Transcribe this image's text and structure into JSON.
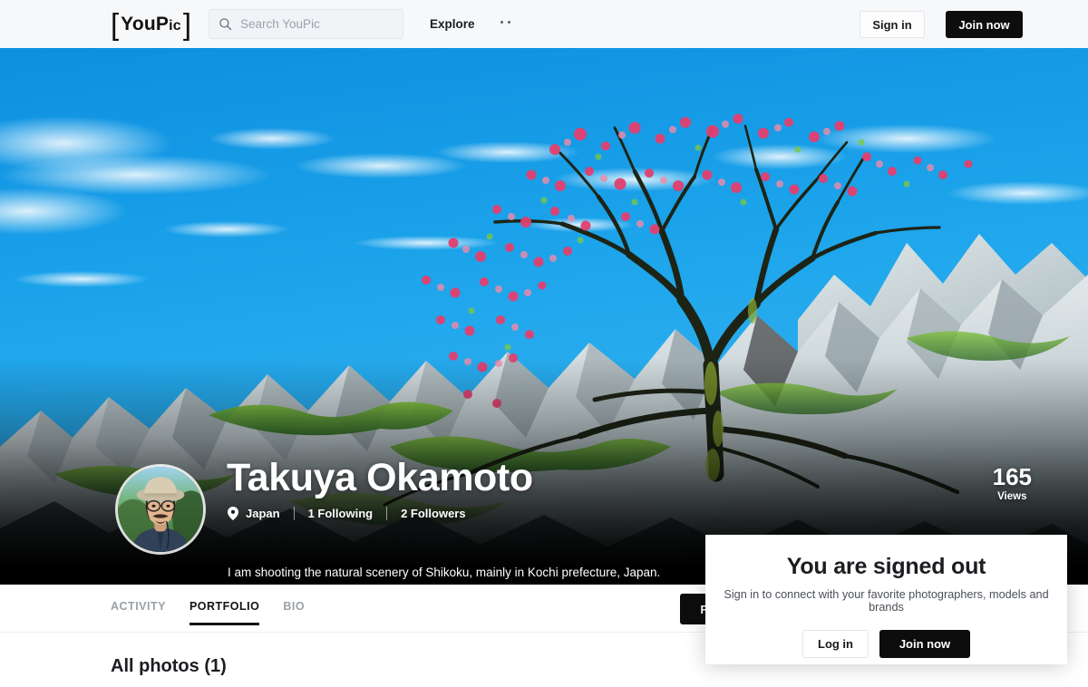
{
  "header": {
    "logo_open": "[",
    "logo_text_you": "You",
    "logo_text_p": "P",
    "logo_text_ic": "ic",
    "logo_close": "]",
    "search": {
      "placeholder": "Search YouPic",
      "value": "",
      "icon": "search-icon"
    },
    "explore_label": "Explore",
    "more_icon": "more-dots-icon",
    "sign_in_label": "Sign in",
    "join_now_label": "Join now"
  },
  "hero": {
    "alt": "Cherry blossom tree on white limestone karst ridge under blue sky",
    "image_subject": "cherry-blossom-tree-limestone-landscape"
  },
  "profile": {
    "avatar_alt": "Portrait of photographer wearing bucket hat and glasses",
    "name": "Takuya Okamoto",
    "location_icon": "location-pin-icon",
    "location": "Japan",
    "following": "1 Following",
    "followers": "2 Followers",
    "bio": "I am shooting the natural scenery of Shikoku, mainly in Kochi prefecture, Japan.",
    "views_count": "165",
    "views_label": "Views"
  },
  "tabs": [
    {
      "label": "ACTIVITY",
      "active": false
    },
    {
      "label": "PORTFOLIO",
      "active": true
    },
    {
      "label": "BIO",
      "active": false
    }
  ],
  "actions": {
    "follow_label": "Follow"
  },
  "content": {
    "all_photos_title": "All photos (1)"
  },
  "modal": {
    "title": "You are signed out",
    "subtitle": "Sign in to connect with your favorite photographers, models and brands",
    "log_in_label": "Log in",
    "join_now_label": "Join now"
  },
  "colors": {
    "accent_dark": "#0d0d0d",
    "nav_background": "#f7f8fa",
    "tab_active": "#121417",
    "tab_inactive": "#9aa0a8",
    "sky_blue": "#1aa0e8",
    "blossom_pink": "#e4507a"
  }
}
